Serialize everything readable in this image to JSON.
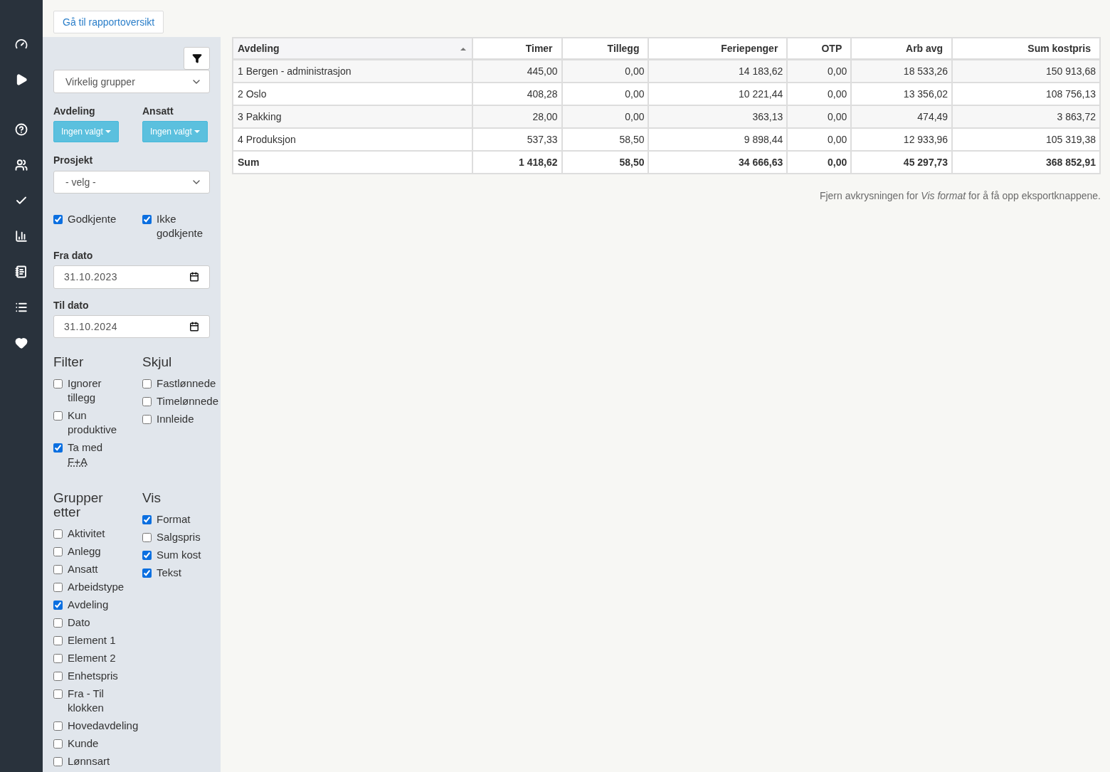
{
  "top_button": "Gå til rapportoversikt",
  "panel": {
    "group_select": "Virkelig grupper",
    "pickers": [
      {
        "label": "Avdeling",
        "button": "Ingen valgt"
      },
      {
        "label": "Ansatt",
        "button": "Ingen valgt"
      }
    ],
    "project": {
      "label": "Prosjekt",
      "value": "- velg -"
    },
    "approval": [
      {
        "label": "Godkjente",
        "checked": true
      },
      {
        "label": "Ikke godkjente",
        "checked": true
      }
    ],
    "dates": [
      {
        "label": "Fra dato",
        "value": "31.10.2023"
      },
      {
        "label": "Til dato",
        "value": "31.10.2024"
      }
    ],
    "groups": [
      {
        "title": "Filter",
        "items": [
          {
            "label": "Ignorer tillegg",
            "checked": false
          },
          {
            "label": "Kun produktive",
            "checked": false
          },
          {
            "label": "Ta med",
            "abbr": "F+A",
            "checked": true
          }
        ]
      },
      {
        "title": "Skjul",
        "items": [
          {
            "label": "Fastlønnede",
            "checked": false
          },
          {
            "label": "Timelønnede",
            "checked": false
          },
          {
            "label": "Innleide",
            "checked": false
          }
        ]
      },
      {
        "title": "Grupper etter",
        "items": [
          {
            "label": "Aktivitet",
            "checked": false
          },
          {
            "label": "Anlegg",
            "checked": false
          },
          {
            "label": "Ansatt",
            "checked": false
          },
          {
            "label": "Arbeidstype",
            "checked": false
          },
          {
            "label": "Avdeling",
            "checked": true
          },
          {
            "label": "Dato",
            "checked": false
          },
          {
            "label": "Element 1",
            "checked": false
          },
          {
            "label": "Element 2",
            "checked": false
          },
          {
            "label": "Enhetspris",
            "checked": false
          },
          {
            "label": "Fra - Til klokken",
            "checked": false
          },
          {
            "label": "Hovedavdeling",
            "checked": false
          },
          {
            "label": "Kunde",
            "checked": false
          },
          {
            "label": "Lønnsart",
            "checked": false
          }
        ]
      },
      {
        "title": "Vis",
        "items": [
          {
            "label": "Format",
            "checked": true
          },
          {
            "label": "Salgspris",
            "checked": false
          },
          {
            "label": "Sum kost",
            "checked": true
          },
          {
            "label": "Tekst",
            "checked": true
          }
        ]
      }
    ]
  },
  "table": {
    "columns": [
      {
        "label": "Avdeling",
        "sorted": true
      },
      {
        "label": "Timer",
        "sorted": false
      },
      {
        "label": "Tillegg",
        "sorted": false
      },
      {
        "label": "Feriepenger",
        "sorted": false
      },
      {
        "label": "OTP",
        "sorted": false
      },
      {
        "label": "Arb avg",
        "sorted": false
      },
      {
        "label": "Sum kostpris",
        "sorted": false
      }
    ],
    "rows": [
      [
        "1 Bergen - administrasjon",
        "445,00",
        "0,00",
        "14 183,62",
        "0,00",
        "18 533,26",
        "150 913,68"
      ],
      [
        "2 Oslo",
        "408,28",
        "0,00",
        "10 221,44",
        "0,00",
        "13 356,02",
        "108 756,13"
      ],
      [
        "3 Pakking",
        "28,00",
        "0,00",
        "363,13",
        "0,00",
        "474,49",
        "3 863,72"
      ],
      [
        "4 Produksjon",
        "537,33",
        "58,50",
        "9 898,44",
        "0,00",
        "12 933,96",
        "105 319,38"
      ]
    ],
    "sum_row": [
      "Sum",
      "1 418,62",
      "58,50",
      "34 666,63",
      "0,00",
      "45 297,73",
      "368 852,91"
    ]
  },
  "note": "Fjern avkrysningen for *Vis format* for å få opp eksportknappene."
}
